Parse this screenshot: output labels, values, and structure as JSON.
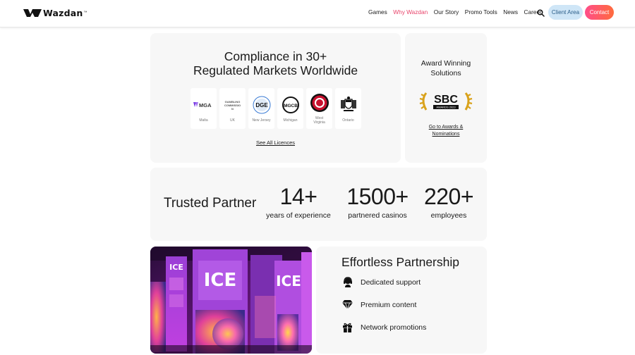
{
  "nav": {
    "logo_text": "Wazdan",
    "logo_tm": "™",
    "menu": [
      {
        "label": "Games"
      },
      {
        "label": "Why Wazdan"
      },
      {
        "label": "Our Story"
      },
      {
        "label": "Promo Tools"
      },
      {
        "label": "News"
      },
      {
        "label": "Career"
      }
    ],
    "active_item": "Why Wazdan",
    "search_icon": "search-icon",
    "client_area_label": "Client Area",
    "contact_label": "Contact"
  },
  "compliance": {
    "title_line1": "Compliance in 30+",
    "title_line2": "Regulated Markets Worldwide",
    "licences": [
      {
        "logo_text": "MGA",
        "name": "Malta"
      },
      {
        "logo_text": "GAMBLING COMMISSION",
        "name": "UK"
      },
      {
        "logo_text": "DGE",
        "name": "New Jersey"
      },
      {
        "logo_text": "MGCB",
        "name": "Michigan"
      },
      {
        "logo_text": "",
        "name": "West Virginia"
      },
      {
        "logo_text": "",
        "name": "Ontario"
      }
    ],
    "see_all_label": "See All Licences"
  },
  "award": {
    "title_line1": "Award Winning",
    "title_line2": "Solutions",
    "badge_text": "SBC",
    "badge_subtext": "AWARDS 2023",
    "link_line1": "Go to Awards &",
    "link_line2": "Nominations"
  },
  "trusted": {
    "label": "Trusted Partner",
    "stats": [
      {
        "value": "14+",
        "label": "years of experience"
      },
      {
        "value": "1500+",
        "label": "partnered casinos"
      },
      {
        "value": "220+",
        "label": "employees"
      }
    ]
  },
  "image": {
    "sign_text": "ICE"
  },
  "partnership": {
    "title": "Effortless Partnership",
    "items": [
      {
        "icon": "headset-icon",
        "label": "Dedicated support"
      },
      {
        "icon": "diamond-icon",
        "label": "Premium content"
      },
      {
        "icon": "gift-icon",
        "label": "Network promotions"
      }
    ]
  },
  "colors": {
    "accent_pink": "#e8436a",
    "contact_gradient_start": "#ff4d8a",
    "contact_gradient_end": "#ff6b3d",
    "client_area_bg": "#cfe6f7",
    "card_bg": "#f7f7f7"
  }
}
